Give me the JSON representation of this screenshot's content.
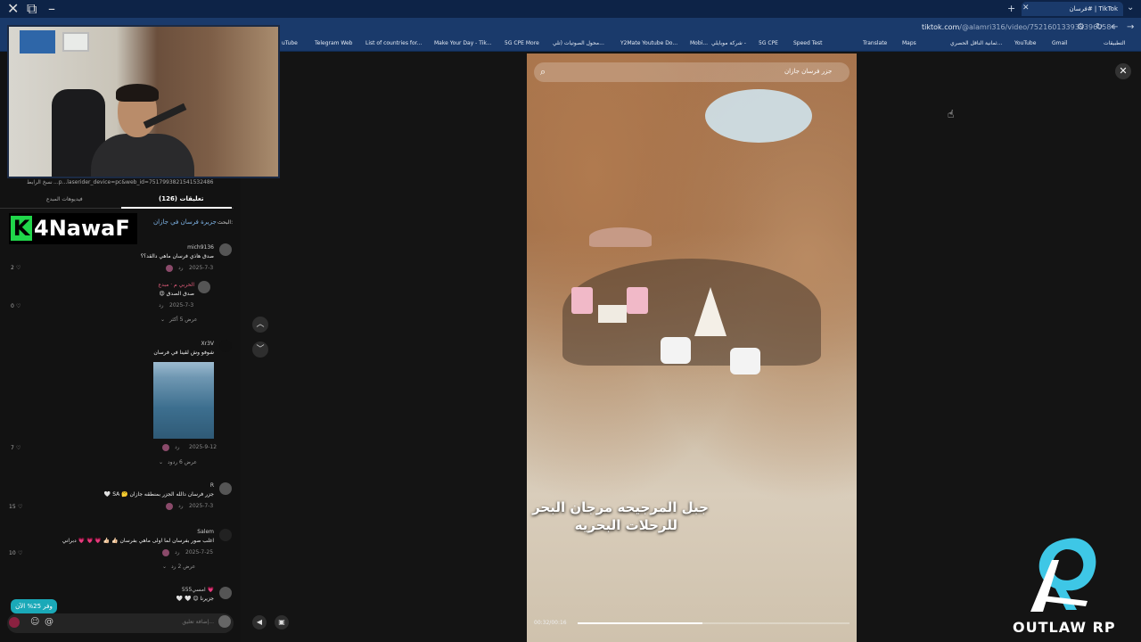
{
  "browser": {
    "active_tab": "TikTok | #فرسان",
    "url_host": "tiktok.com",
    "url_path": "/@alamri316/video/7521601339323960584",
    "bookmarks": [
      "uTube",
      "Telegram Web",
      "List of countries for...",
      "Make Your Day - Tik...",
      "5G CPE More",
      "محول الصوتيات (تلي...",
      "Y2Mate Youtube Do...",
      "Mobi...",
      "شركة موبايلي -",
      "5G CPE",
      "Speed Test",
      "Translate",
      "Maps",
      "ثمانية الناقل الحصري...",
      "YouTube",
      "Gmail",
      "التطبيقات"
    ]
  },
  "overlay": {
    "cam_caption": "...p...laserider_device=pc&web_id=7517993821541532486",
    "side_label": "نسخ الرابط"
  },
  "comments_panel": {
    "tab_videos": "فيديوهات المبدع",
    "tab_comments": "(126) تعليقات",
    "search_label": "البحث:",
    "search_hint": "جزيرة فرسان في جازان",
    "brand": {
      "k": "K",
      "text": "4NawaF"
    },
    "comments": [
      {
        "user": "mich9136",
        "text": "صدق هاذي فرسان ماهي دالقد؟؟",
        "date": "2025-7-3",
        "reply": "رد",
        "likes": "2"
      },
      {
        "user": "الحربي م · مبدع",
        "text": "صدق الصدق 😍",
        "date": "2025-7-3",
        "reply": "رد",
        "likes": "0",
        "more": "عرض 5 أكثر"
      },
      {
        "user": "Xr3V",
        "text": "شوفو وش لقينا في فرسان",
        "date": "2025-9-12",
        "reply": "رد",
        "likes": "7",
        "more": "عرض 6 ردود"
      },
      {
        "user": "R",
        "text": "جزر فرسان دالله الجزر بمنطقه جازان 🤔 SA 🤍",
        "date": "2025-7-3",
        "reply": "رد",
        "likes": "15"
      },
      {
        "user": "Salem",
        "text": "اغلب صور بفرسان لما اولى ماهي بفرسان 👍🏻 👍🏻 💗 💗 💗 دبراني",
        "date": "2025-7-25",
        "reply": "رد",
        "likes": "10",
        "more": "عرض 2 رد"
      },
      {
        "user": "امسي555 💗",
        "text": "جزيرنا 😊 🤍 🤍",
        "date": "",
        "reply": "",
        "likes": ""
      }
    ],
    "promo": "وفر 25% الآن",
    "composer_placeholder": "إضافة تعليق..."
  },
  "video": {
    "search_text": "جزر فرسان جازان",
    "caption_line1": "جبل المرجيحه مرجان البحر",
    "caption_line2": "للرحلات البحريه",
    "time": "00:32/00:16",
    "progress": 0.46
  },
  "logo": {
    "text": "OUTLAW RP"
  },
  "colors": {
    "chrome": "#1a3a6b",
    "brand_green": "#20d64a",
    "promo": "#1aa9b8"
  }
}
